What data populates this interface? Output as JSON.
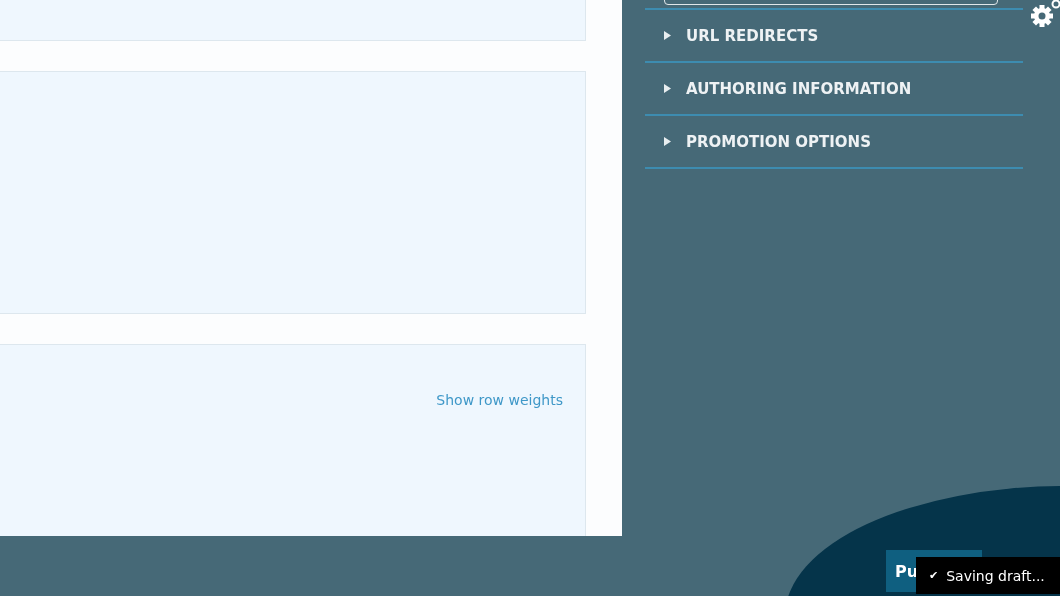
{
  "content": {
    "row_weights_link": "Show row weights"
  },
  "sidebar": {
    "sections": [
      {
        "label": "URL REDIRECTS",
        "expanded": false
      },
      {
        "label": "AUTHORING INFORMATION",
        "expanded": false
      },
      {
        "label": "PROMOTION OPTIONS",
        "expanded": false
      }
    ]
  },
  "footer": {
    "publish_button": "Pu",
    "toast": {
      "icon": "✔",
      "message": "Saving draft..."
    }
  }
}
